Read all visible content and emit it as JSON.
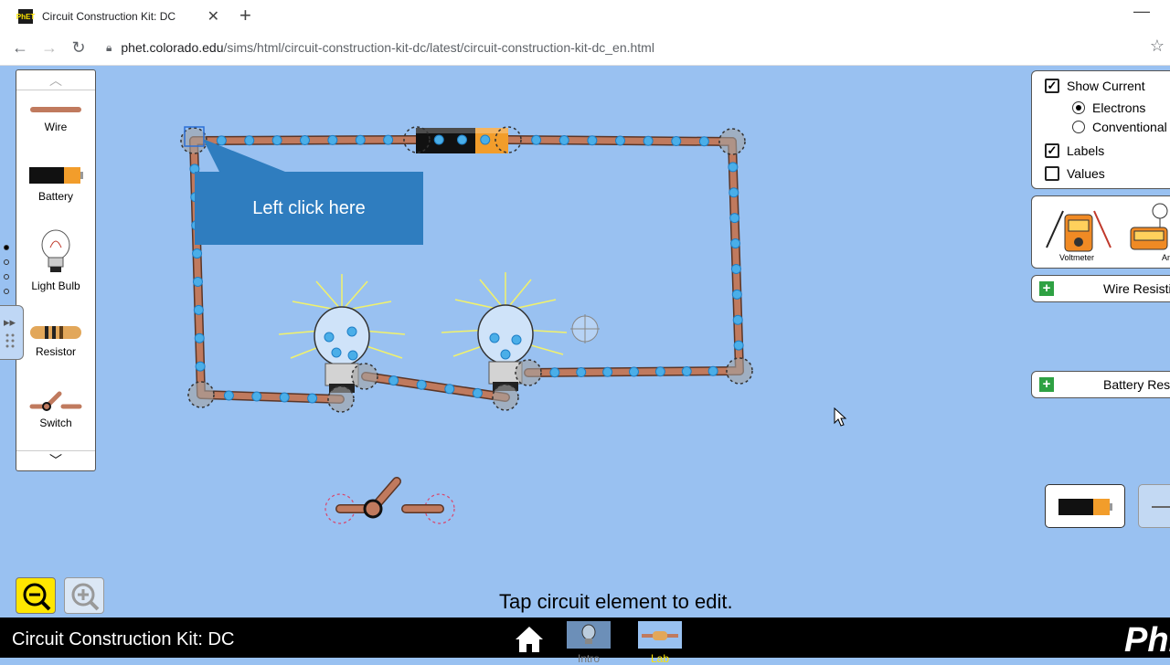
{
  "browser": {
    "tab_title": "Circuit Construction Kit: DC",
    "tab_close": "✕",
    "new_tab": "+",
    "url_host": "phet.colorado.edu",
    "url_path": "/sims/html/circuit-construction-kit-dc/latest/circuit-construction-kit-dc_en.html"
  },
  "toolbox": {
    "items": [
      {
        "label": "Wire"
      },
      {
        "label": "Battery"
      },
      {
        "label": "Light Bulb"
      },
      {
        "label": "Resistor"
      },
      {
        "label": "Switch"
      }
    ]
  },
  "tooltip": {
    "text": "Left click here"
  },
  "controls": {
    "show_current": {
      "label": "Show Current",
      "checked": true
    },
    "electrons": {
      "label": "Electrons",
      "selected": true
    },
    "conventional": {
      "label": "Conventional",
      "selected": false
    },
    "labels": {
      "label": "Labels",
      "checked": true
    },
    "values": {
      "label": "Values",
      "checked": false
    }
  },
  "sensors": {
    "voltmeter_label": "Voltmeter",
    "ammeter_label": "Amm"
  },
  "accordions": {
    "wire_resistivity": "Wire Resistivi",
    "battery_resistance": "Battery Resista"
  },
  "status": {
    "text": "Tap circuit element to edit."
  },
  "navbar": {
    "title": "Circuit Construction Kit: DC",
    "screens": [
      {
        "label": "Intro"
      },
      {
        "label": "Lab"
      }
    ],
    "logo": "PhET"
  },
  "colors": {
    "play_area": "#99c1f1",
    "wire": "#c07a5e",
    "electron": "#4aaee8",
    "tooltip_bg": "#2f7dbf",
    "zoom_out_bg": "#ffe600",
    "accent_green": "#2ea143",
    "navbar_bg": "#000000"
  }
}
